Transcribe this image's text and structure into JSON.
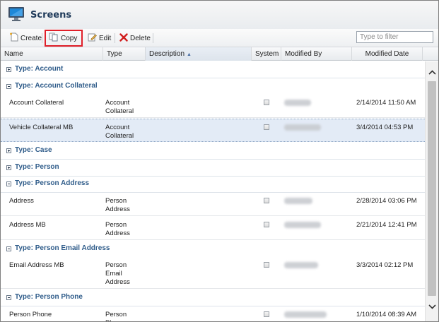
{
  "window": {
    "title": "Screens",
    "icon": "monitor-icon"
  },
  "toolbar": {
    "create_label": "Create",
    "copy_label": "Copy",
    "edit_label": "Edit",
    "delete_label": "Delete",
    "filter_placeholder": "Type to filter",
    "highlight_color": "#e0202a"
  },
  "columns": {
    "name": "Name",
    "type": "Type",
    "description": "Description",
    "system": "System",
    "modified_by": "Modified By",
    "modified_date": "Modified Date"
  },
  "groups": [
    {
      "label": "Type: Account",
      "expanded": false,
      "rows": []
    },
    {
      "label": "Type: Account Collateral",
      "expanded": true,
      "rows": [
        {
          "name": "Account Collateral",
          "type": [
            "Account",
            "Collateral"
          ],
          "date": "2/14/2014 11:50 AM",
          "selected": false
        },
        {
          "name": "Vehicle Collateral MB",
          "type": [
            "Account",
            "Collateral"
          ],
          "date": "3/4/2014 04:53 PM",
          "selected": true
        }
      ]
    },
    {
      "label": "Type: Case",
      "expanded": false,
      "rows": []
    },
    {
      "label": "Type: Person",
      "expanded": false,
      "rows": []
    },
    {
      "label": "Type: Person Address",
      "expanded": true,
      "rows": [
        {
          "name": "Address",
          "type": [
            "Person",
            "Address"
          ],
          "date": "2/28/2014 03:06 PM",
          "selected": false
        },
        {
          "name": "Address MB",
          "type": [
            "Person",
            "Address"
          ],
          "date": "2/21/2014 12:41 PM",
          "selected": false
        }
      ]
    },
    {
      "label": "Type: Person Email Address",
      "expanded": true,
      "rows": [
        {
          "name": "Email Address MB",
          "type": [
            "Person",
            "Email",
            "Address"
          ],
          "date": "3/3/2014 02:12 PM",
          "selected": false
        }
      ]
    },
    {
      "label": "Type: Person Phone",
      "expanded": true,
      "rows": [
        {
          "name": "Person Phone",
          "type": [
            "Person",
            "Phone"
          ],
          "date": "1/10/2014 08:39 AM",
          "selected": false
        }
      ]
    }
  ]
}
